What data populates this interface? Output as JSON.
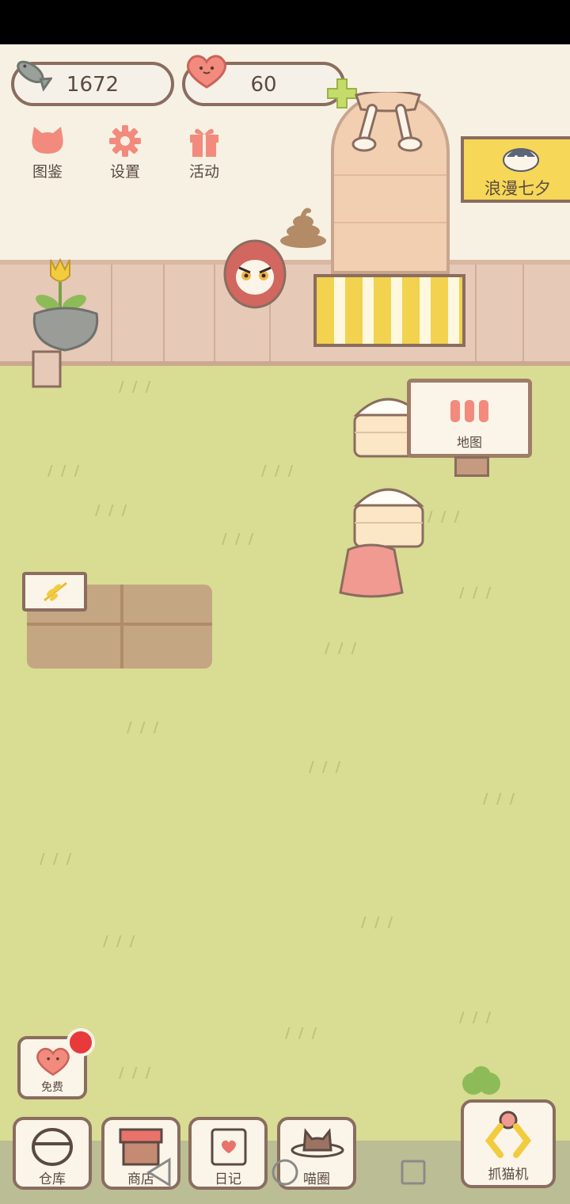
{
  "resources": {
    "fish_count": "1672",
    "heart_count": "60"
  },
  "menu": [
    {
      "label": "图鉴",
      "icon": "cat-head-icon"
    },
    {
      "label": "设置",
      "icon": "gear-icon"
    },
    {
      "label": "活动",
      "icon": "gift-icon"
    }
  ],
  "event_banner": {
    "label": "浪漫七夕"
  },
  "map_sign": {
    "label": "地图"
  },
  "free_button": {
    "label": "免费"
  },
  "bottom_nav": [
    {
      "label": "仓库",
      "icon": "storage-icon"
    },
    {
      "label": "商店",
      "icon": "shop-icon"
    },
    {
      "label": "日记",
      "icon": "diary-icon"
    },
    {
      "label": "喵圈",
      "icon": "cat-planet-icon"
    }
  ],
  "claw_machine": {
    "label": "抓猫机"
  },
  "colors": {
    "grass": "#d9dc93",
    "wall": "#f6f1e3",
    "fence": "#e6c9b7",
    "outline": "#8a6d5f",
    "accent_heart": "#f28b7d",
    "banner": "#f7d757",
    "notification": "#e83a3a"
  }
}
